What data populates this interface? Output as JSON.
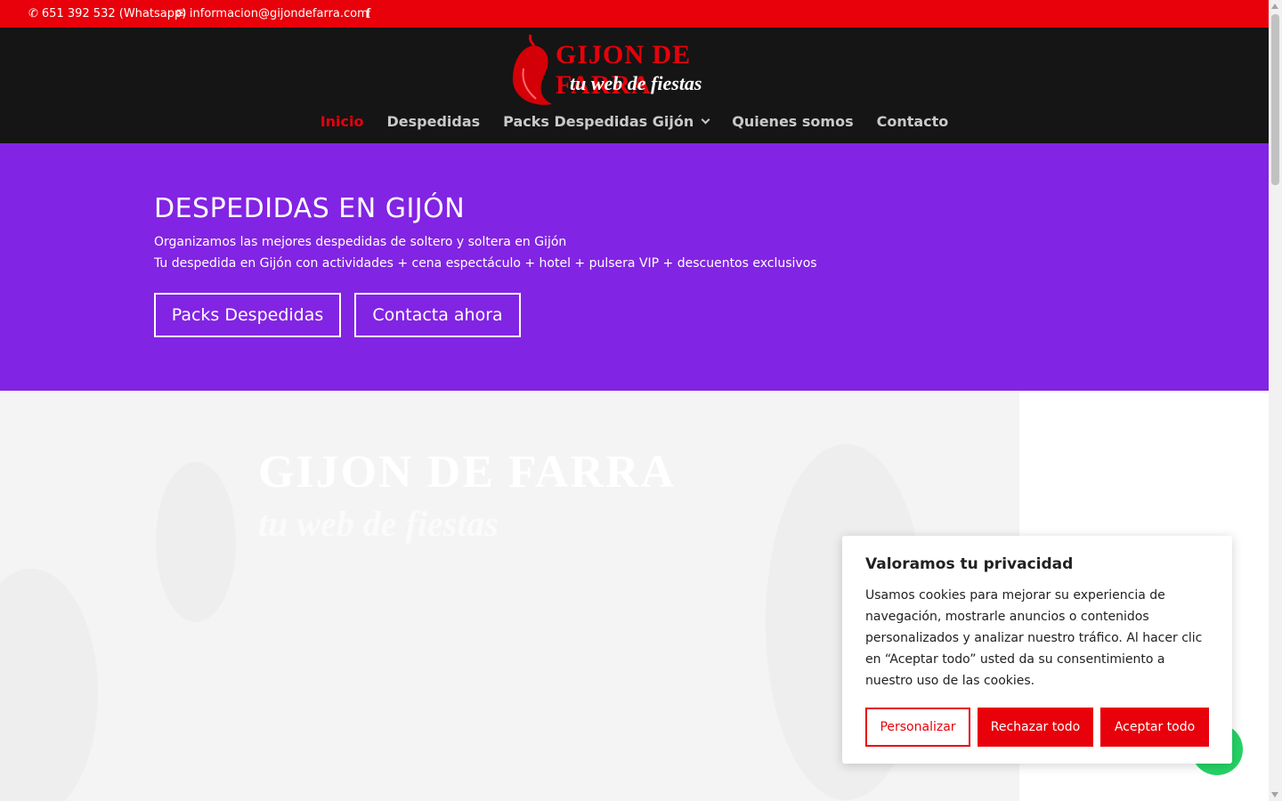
{
  "topbar": {
    "phone": "651 392 532 (Whatsapp)",
    "email": "informacion@gijondefarra.com",
    "facebook_icon": "facebook-icon"
  },
  "logo": {
    "title": "GIJON DE FARRA",
    "subtitle": "tu web de fiestas"
  },
  "nav": {
    "items": [
      {
        "label": "Inicio",
        "active": true
      },
      {
        "label": "Despedidas"
      },
      {
        "label": "Packs Despedidas Gijón",
        "has_dropdown": true
      },
      {
        "label": "Quienes somos"
      },
      {
        "label": "Contacto"
      }
    ]
  },
  "hero": {
    "title": "DESPEDIDAS EN GIJÓN",
    "line1": "Organizamos las mejores despedidas de soltero y soltera en Gijón",
    "line2": "Tu despedida en Gijón con actividades + cena espectáculo + hotel + pulsera VIP + descuentos exclusivos",
    "button1": "Packs Despedidas",
    "button2": "Contacta ahora"
  },
  "photo": {
    "overlay_title": "GIJON DE FARRA",
    "overlay_subtitle": "tu web de fiestas"
  },
  "cookie": {
    "title": "Valoramos tu privacidad",
    "text": "Usamos cookies para mejorar su experiencia de navegación, mostrarle anuncios o contenidos personalizados y analizar nuestro tráfico. Al hacer clic en “Aceptar todo” usted da su consentimiento a nuestro uso de las cookies.",
    "customize": "Personalizar",
    "reject": "Rechazar todo",
    "accept": "Aceptar todo"
  },
  "colors": {
    "brand_red": "#e8000b",
    "hero_purple": "#8224e3",
    "header_dark": "#151515",
    "whatsapp_green": "#25d366"
  }
}
